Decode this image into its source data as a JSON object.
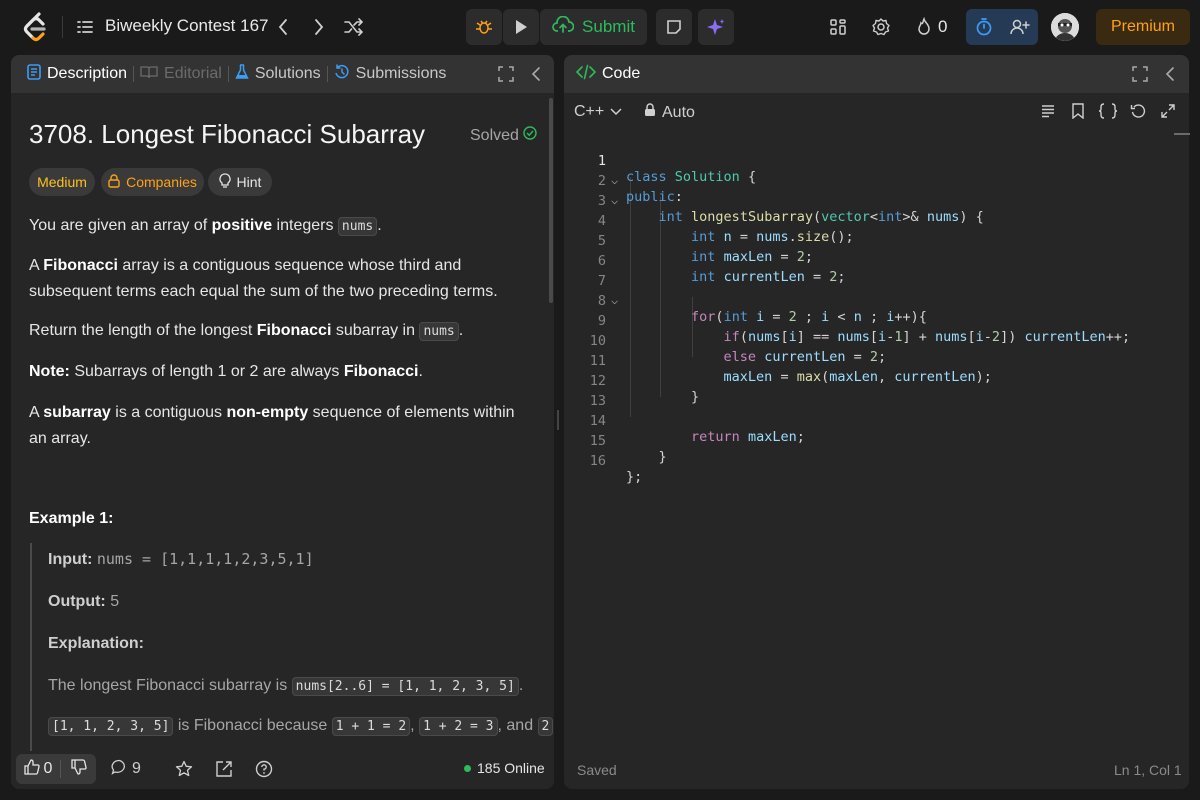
{
  "topbar": {
    "contest_title": "Biweekly Contest 167",
    "submit_label": "Submit",
    "fire_count": "0",
    "premium_label": "Premium",
    "accent_color": "#ffa116",
    "submit_color": "#2cbb5d"
  },
  "left_panel": {
    "tabs": [
      {
        "label": "Description",
        "icon": "description-icon",
        "state": "active"
      },
      {
        "label": "Editorial",
        "icon": "editorial-icon",
        "state": "disabled"
      },
      {
        "label": "Solutions",
        "icon": "flask-icon",
        "state": "normal"
      },
      {
        "label": "Submissions",
        "icon": "history-icon",
        "state": "normal"
      }
    ],
    "problem_title": "3708. Longest Fibonacci Subarray",
    "solved_label": "Solved",
    "chips": {
      "difficulty": "Medium",
      "companies": "Companies",
      "hint": "Hint"
    },
    "description": {
      "p1_a": "You are given an array of ",
      "p1_b": "positive",
      "p1_c": " integers ",
      "p1_code": "nums",
      "p1_d": ".",
      "p2_a": "A ",
      "p2_b": "Fibonacci",
      "p2_c": " array is a contiguous sequence whose third and subsequent terms each equal the sum of the two preceding terms.",
      "p3_a": "Return the length of the longest ",
      "p3_b": "Fibonacci",
      "p3_c": " subarray in ",
      "p3_code": "nums",
      "p3_d": ".",
      "p4_a": "Note:",
      "p4_b": " Subarrays of length 1 or 2 are always ",
      "p4_c": "Fibonacci",
      "p4_d": ".",
      "p5_a": "A ",
      "p5_b": "subarray",
      "p5_c": " is a contiguous ",
      "p5_d": "non-empty",
      "p5_e": " sequence of elements within an array."
    },
    "example": {
      "title": "Example 1:",
      "input_label": "Input:",
      "input_value": "nums = [1,1,1,1,2,3,5,1]",
      "output_label": "Output:",
      "output_value": " 5",
      "explanation_label": "Explanation:",
      "exp1_text": "The longest Fibonacci subarray is ",
      "exp1_code": "nums[2..6] = [1, 1, 2, 3, 5]",
      "exp1_end": ".",
      "exp2_code1": "[1, 1, 2, 3, 5]",
      "exp2_text1": " is Fibonacci because ",
      "exp2_code2": "1 + 1 = 2",
      "exp2_sep": ", ",
      "exp2_code3": "1 + 2 = 3",
      "exp2_text2": ", and ",
      "exp2_code4": "2"
    },
    "footer": {
      "likes": "0",
      "comments": "9",
      "online": "185 Online"
    }
  },
  "right_panel": {
    "title": "Code",
    "language": "C++",
    "mode": "Auto",
    "status": "Saved",
    "cursor": "Ln 1, Col 1",
    "code_lines": [
      "class Solution {",
      "public:",
      "    int longestSubarray(vector<int>& nums) {",
      "        int n = nums.size();",
      "        int maxLen = 2;",
      "        int currentLen = 2;",
      "",
      "        for(int i = 2 ; i < n ; i++){",
      "            if(nums[i] == nums[i-1] + nums[i-2]) currentLen++;",
      "            else currentLen = 2;",
      "            maxLen = max(maxLen, currentLen);",
      "        }",
      "",
      "        return maxLen;",
      "    }",
      "};"
    ],
    "line_numbers": [
      "1",
      "2",
      "3",
      "4",
      "5",
      "6",
      "7",
      "8",
      "9",
      "10",
      "11",
      "12",
      "13",
      "14",
      "15",
      "16"
    ]
  }
}
